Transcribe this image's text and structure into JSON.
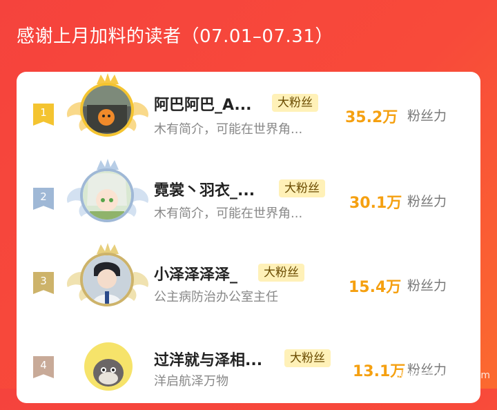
{
  "page": {
    "title": "感谢上月加料的读者（07.01–07.31）",
    "badge_label": "大粉丝",
    "unit_label": "粉丝力",
    "watermark": "漫画天堂hipmh.com"
  },
  "colors": {
    "background_start": "#f5433d",
    "background_end": "#fb6a2f",
    "score": "#f5a010",
    "badge_bg": "#fff1b8",
    "rank_1": "#f4c430",
    "rank_2": "#9fb8d6",
    "rank_3": "#cdb36a",
    "rank_4": "#c8aa98"
  },
  "readers": [
    {
      "rank": "1",
      "name": "阿巴阿巴_A...",
      "bio": "木有简介，可能在世界角...",
      "score": "35.2万",
      "frame": "gold"
    },
    {
      "rank": "2",
      "name": "霓裳丶羽衣_...",
      "bio": "木有简介，可能在世界角...",
      "score": "30.1万",
      "frame": "silver"
    },
    {
      "rank": "3",
      "name": "小泽泽泽泽_",
      "bio": "公主病防治办公室主任",
      "score": "15.4万",
      "frame": "bronze"
    },
    {
      "rank": "4",
      "name": "过洋就与泽相...",
      "bio": "洋启航泽万物",
      "score": "13.1万",
      "frame": "none"
    }
  ]
}
